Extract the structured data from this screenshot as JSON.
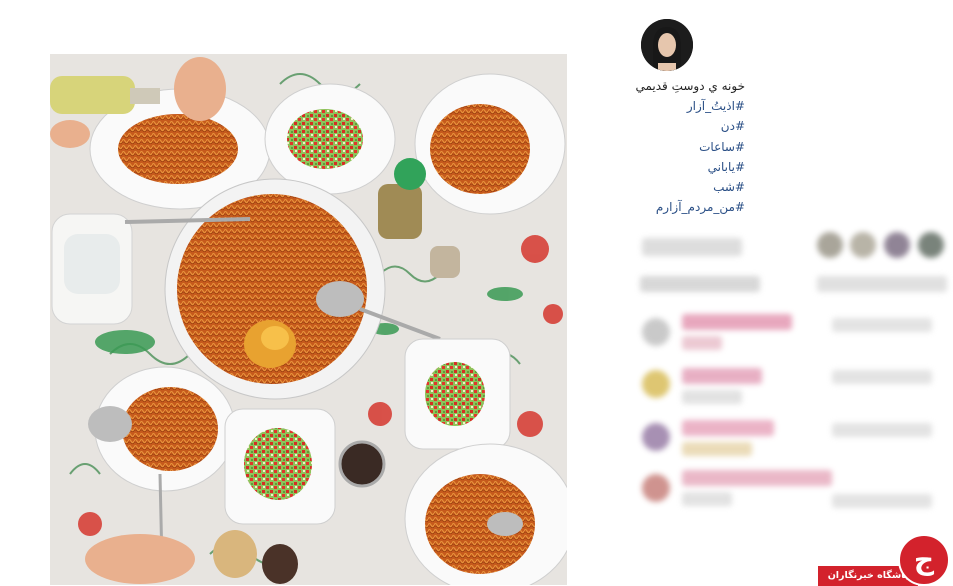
{
  "post": {
    "caption_lines": [
      "خونه ي دوستِ قديمي",
      "#اذيتُ_آزار",
      "#دن",
      "#ساعات",
      "#ياباني",
      "#شب",
      "#من_مردم_آزارم"
    ]
  },
  "colors": {
    "hashtag": "#2a4f86",
    "text": "#222222",
    "brand_red": "#d3222c"
  },
  "icons": {
    "avatar": "profile-avatar",
    "logo": "club-logo"
  },
  "watermark": {
    "site_name": "باشگاه خبرنگاران",
    "logo_glyph": "ج"
  }
}
